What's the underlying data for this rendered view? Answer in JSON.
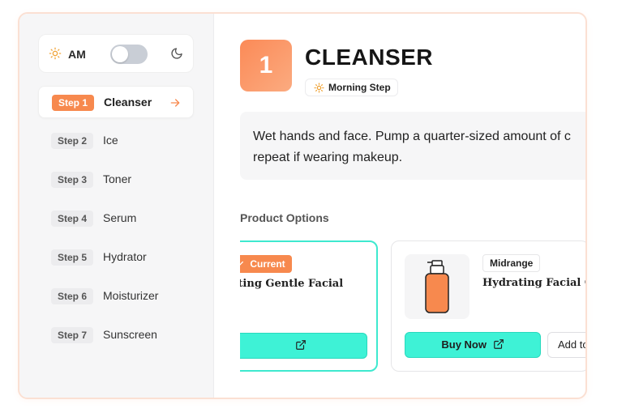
{
  "mode": {
    "label": "AM",
    "toggle_on": false
  },
  "steps": [
    {
      "badge": "Step 1",
      "name": "Cleanser",
      "active": true
    },
    {
      "badge": "Step 2",
      "name": "Ice"
    },
    {
      "badge": "Step 3",
      "name": "Toner"
    },
    {
      "badge": "Step 4",
      "name": "Serum"
    },
    {
      "badge": "Step 5",
      "name": "Hydrator"
    },
    {
      "badge": "Step 6",
      "name": "Moisturizer"
    },
    {
      "badge": "Step 7",
      "name": "Sunscreen"
    }
  ],
  "detail": {
    "number": "1",
    "title": "CLEANSER",
    "tag": "Morning Step",
    "instructions_line1": "Wet hands and face. Pump a quarter-sized amount of c",
    "instructions_line2": "repeat if wearing makeup."
  },
  "products": {
    "heading": "Product Options",
    "current": {
      "badge": "Current",
      "name": "ating Gentle Facial",
      "buy_label": ""
    },
    "alt": {
      "tier": "Midrange",
      "name": "Hydrating Facial Cle",
      "buy_label": "Buy Now",
      "add_label": "Add to"
    }
  },
  "colors": {
    "accent": "#f7894e",
    "teal": "#3ef2d6"
  }
}
